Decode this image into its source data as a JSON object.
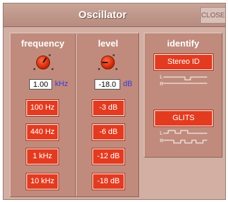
{
  "window": {
    "title": "Oscillator",
    "close_label": "CLOSE"
  },
  "frequency": {
    "heading": "frequency",
    "value": "1.00",
    "unit": "kHz",
    "presets": [
      "100 Hz",
      "440 Hz",
      "1 kHz",
      "10 kHz"
    ]
  },
  "level": {
    "heading": "level",
    "value": "-18.0",
    "unit": "dB",
    "presets": [
      "-3 dB",
      "-6 dB",
      "-12 dB",
      "-18 dB"
    ]
  },
  "identify": {
    "heading": "identify",
    "stereo_id_label": "Stereo ID",
    "glits_label": "GLITS",
    "channel_left": "L",
    "channel_right": "R"
  },
  "colors": {
    "accent": "#e33b20",
    "panel": "#c08b7c",
    "background": "#d2aea3",
    "unit_text": "#3a3ad6"
  }
}
